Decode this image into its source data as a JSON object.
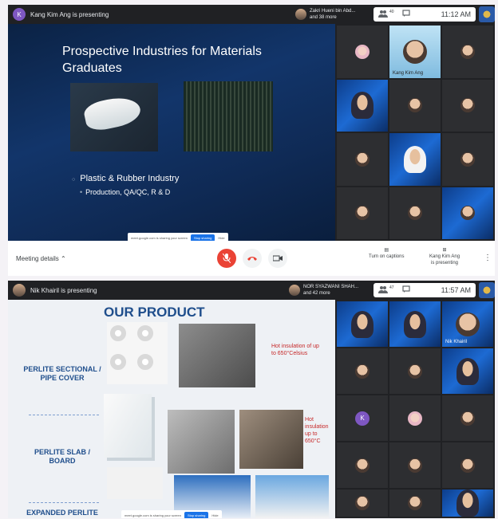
{
  "meet1": {
    "avatar_letter": "K",
    "presenting": "Kang Kim Ang is presenting",
    "people_line1": "Zakri Hueni bin Abd...",
    "people_line2": "and 38 more",
    "participant_count": "40",
    "time": "11:12 AM",
    "slide": {
      "title": "Prospective Industries for Materials Graduates",
      "bullet1": "Plastic & Rubber Industry",
      "bullet2": "Production, QA/QC, R & D"
    },
    "share_text": "meet.google.com is sharing your screen",
    "stop_label": "Stop sharing",
    "hide_label": "Hide",
    "speaker_tile": "Kang Kim Ang",
    "meeting_details": "Meeting details",
    "captions_label": "Turn on captions",
    "presenter_name": "Kang Kim Ang",
    "presenter_status": "is presenting"
  },
  "meet2": {
    "presenting": "Nik Khairil is presenting",
    "people_line1": "NOR SYAZWANI SHAH...",
    "people_line2": "and 42 more",
    "participant_count": "47",
    "time": "11:57 AM",
    "slide": {
      "title": "OUR PRODUCT",
      "product1": "PERLITE SECTIONAL / PIPE COVER",
      "product2": "PERLITE SLAB / BOARD",
      "product3": "EXPANDED PERLITE POWDER",
      "note1": "Hot insulation of up to 650°Celsius",
      "note2": "Hot insulation up to 650°C"
    },
    "share_text": "meet.google.com is sharing your screen",
    "stop_label": "Stop sharing",
    "hide_label": "Hide",
    "tile_avatar_letter": "K",
    "speaker_tile": "Nik Khairil"
  },
  "icons": [
    "people-icon",
    "chat-icon",
    "mic-off-icon",
    "end-call-icon",
    "camera-icon",
    "captions-icon",
    "present-icon",
    "more-icon",
    "chevron-up-icon"
  ],
  "colors": {
    "meet_bg": "#202124",
    "end_call": "#ea4335",
    "accent_blue": "#1a73e8",
    "slide2_title": "#1f4e8c"
  }
}
